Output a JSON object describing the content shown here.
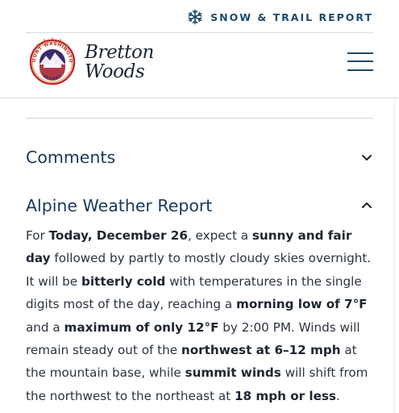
{
  "topbar": {
    "snow_report_label": "SNOW & TRAIL REPORT",
    "snow_icon": "snowflake-icon"
  },
  "header": {
    "logo_icon": "bretton-woods-seal-logo",
    "logo_text": "MOUNT WASHINGTON RESORT",
    "brand_line1": "Bretton",
    "brand_line2": "Woods",
    "menu_icon": "hamburger-menu-icon"
  },
  "accordion": {
    "comments": {
      "title": "Comments",
      "state": "collapsed",
      "icon": "chevron-down-icon"
    },
    "weather": {
      "title": "Alpine Weather Report",
      "state": "expanded",
      "icon": "chevron-up-icon"
    }
  },
  "report": {
    "t1": "For ",
    "b1": "Today, December 26",
    "t2": ", expect a ",
    "b2": "sunny and fair day",
    "t3": " followed by partly to mostly cloudy skies overnight. It will be ",
    "b3": "bitterly cold",
    "t4": " with temperatures in the single digits most of the day, reaching a ",
    "b4": "morning low of 7°F",
    "t5": " and a ",
    "b5": "maximum of only 12°F",
    "t6": " by 2:00 PM. Winds will remain steady out of the ",
    "b6": "northwest at 6–12 mph",
    "t7": " at the mountain base, while ",
    "b7": "summit winds",
    "t8": " will shift from the northwest to the northeast at ",
    "b8": "18 mph or less",
    "t9": "."
  },
  "colors": {
    "accent_navy": "#1d4a6b",
    "heading_navy": "#18385a",
    "logo_red": "#c1272d",
    "logo_purple": "#3b2a6b",
    "logo_gold": "#d9a441"
  }
}
